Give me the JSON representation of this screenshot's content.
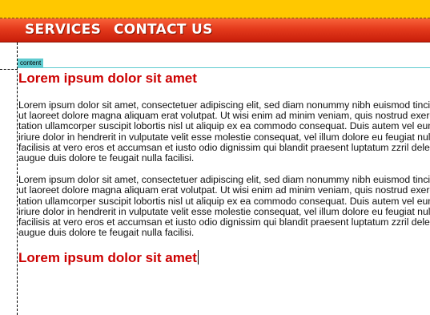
{
  "nav": {
    "services_label": "SERVICES",
    "contact_label": "CONTACT US"
  },
  "editor": {
    "region_tag": "content"
  },
  "content": {
    "heading1": "Lorem ipsum dolor sit amet",
    "paragraph1": "Lorem ipsum dolor sit amet, consectetuer adipiscing elit, sed diam nonummy nibh euismod tincidunt ut laoreet dolore magna aliquam erat volutpat. Ut wisi enim ad minim veniam, quis nostrud exerci tation ullamcorper suscipit lobortis nisl ut aliquip ex ea commodo consequat. Duis autem vel eum iriure dolor in hendrerit in vulputate velit esse molestie consequat, vel illum dolore eu feugiat nulla facilisis at vero eros et accumsan et iusto odio dignissim qui blandit praesent luptatum zzril delenit augue duis dolore te feugait nulla facilisi.",
    "paragraph2": "Lorem ipsum dolor sit amet, consectetuer adipiscing elit, sed diam nonummy nibh euismod tincidunt ut laoreet dolore magna aliquam erat volutpat. Ut wisi enim ad minim veniam, quis nostrud exerci tation ullamcorper suscipit lobortis nisl ut aliquip ex ea commodo consequat. Duis autem vel eum iriure dolor in hendrerit in vulputate velit esse molestie consequat, vel illum dolore eu feugiat nulla facilisis at vero eros et accumsan et iusto odio dignissim qui blandit praesent luptatum zzril delenit augue duis dolore te feugait nulla facilisi.",
    "heading2": "Lorem ipsum dolor sit amet"
  },
  "colors": {
    "topbar": "#ffc800",
    "navbar": "#e43a1c",
    "heading": "#cc0000",
    "region_tag": "#5fcbd0"
  }
}
